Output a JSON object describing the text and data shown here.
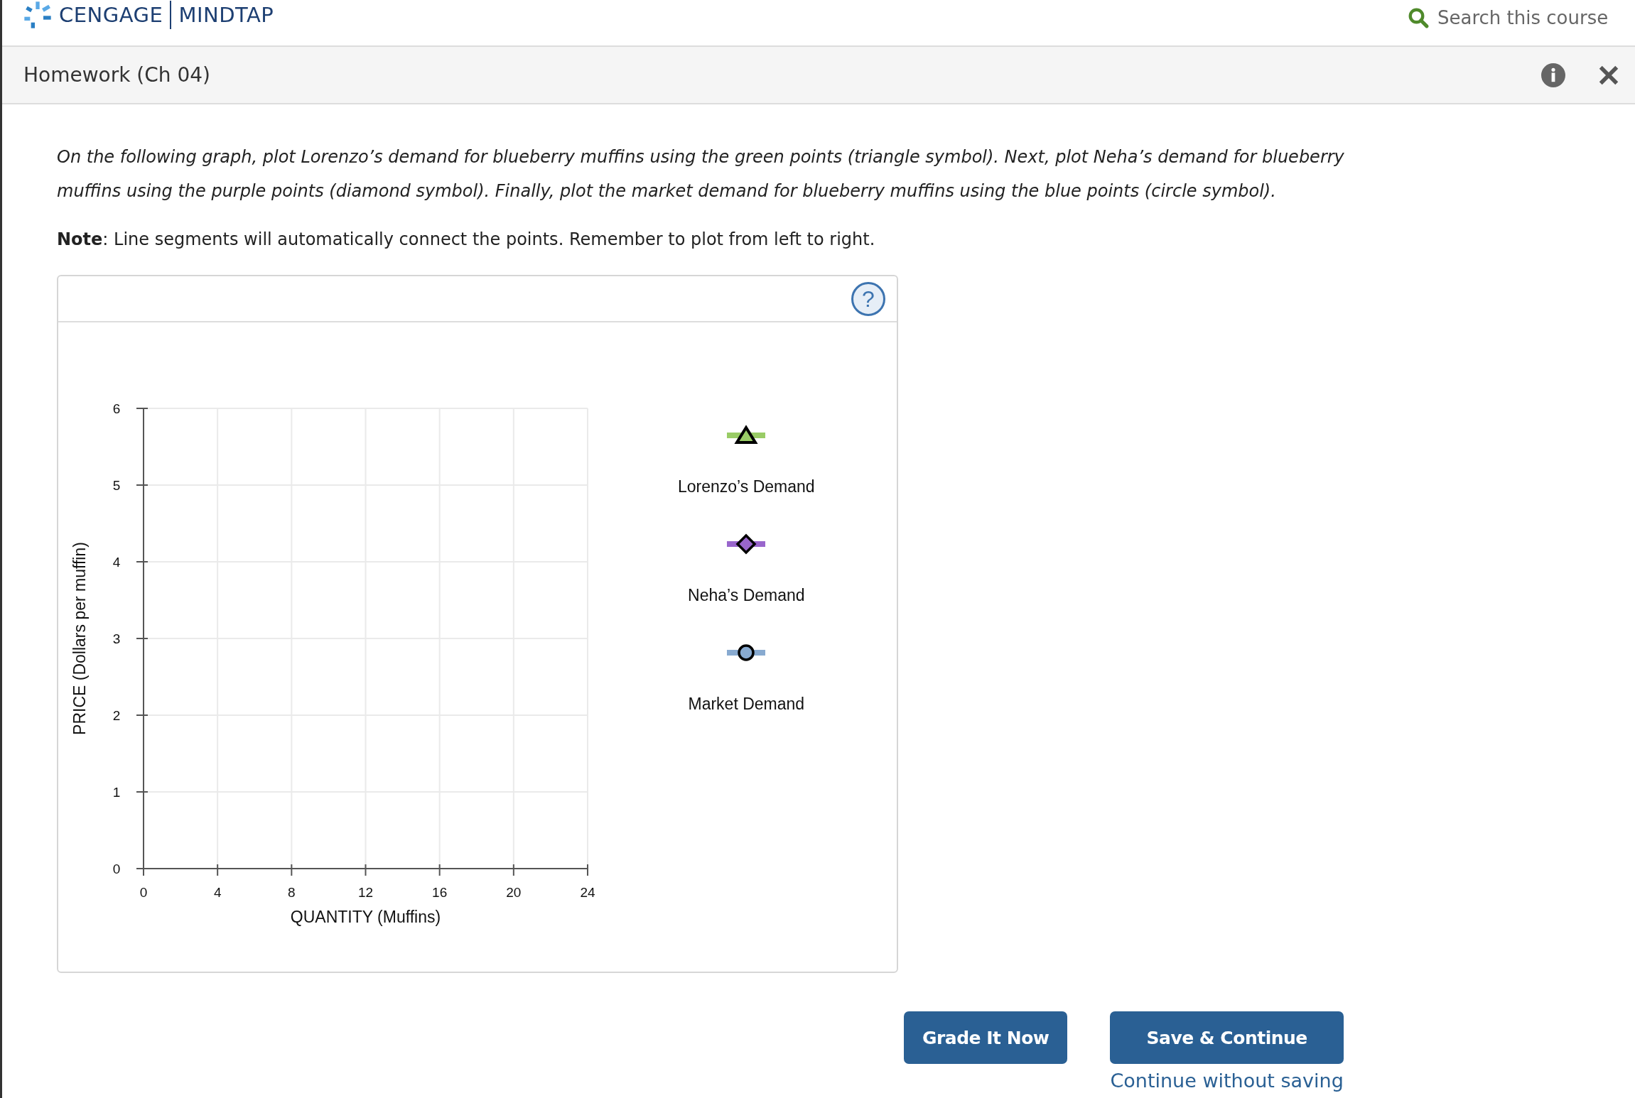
{
  "header": {
    "brand": "CENGAGE",
    "product": "MINDTAP",
    "search": {
      "placeholder": "Search this course"
    }
  },
  "title_bar": {
    "title": "Homework (Ch 04)"
  },
  "instructions": "On the following graph, plot Lorenzo’s demand for blueberry muffins using the green points (triangle symbol). Next, plot Neha’s demand for blueberry muffins using the purple points (diamond symbol). Finally, plot the market demand for blueberry muffins using the blue points (circle symbol).",
  "note": "**Note**: Line segments will automatically connect the points. Remember to plot from left to right.",
  "graph": {
    "help": "?",
    "chart_data": {
      "type": "line",
      "grid": true,
      "xlabel": "QUANTITY (Muffins)",
      "ylabel": "PRICE (Dollars per muffin)",
      "xlim": [
        0,
        24
      ],
      "ylim": [
        0,
        6
      ],
      "xticks": [
        0,
        4,
        8,
        12,
        16,
        20,
        24
      ],
      "yticks": [
        0,
        1,
        2,
        3,
        4,
        5,
        6
      ]
    },
    "palette": [
      {
        "kind": "triangle",
        "label": "Lorenzo’s Demand",
        "color": "#99cc66"
      },
      {
        "kind": "diamond",
        "label": "Neha’s Demand",
        "color": "#9966cc"
      },
      {
        "kind": "circle",
        "label": "Market Demand",
        "color": "#88aad0"
      }
    ]
  },
  "buttons": [
    "Grade It Now",
    "Save & Continue"
  ],
  "link": "Continue without saving"
}
